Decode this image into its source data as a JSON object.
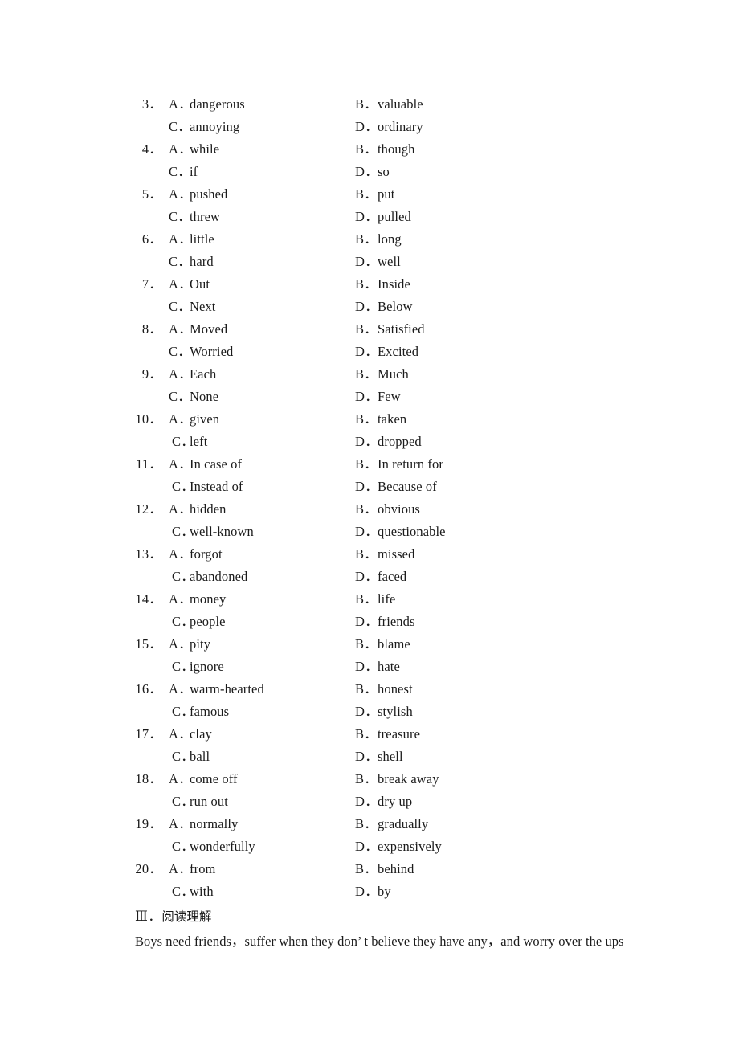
{
  "page": {
    "background_color": "#ffffff",
    "text_color": "#1b1b1b"
  },
  "questions": [
    {
      "number": "3．",
      "options": [
        {
          "label": "A．",
          "text": "dangerous"
        },
        {
          "label": "B．",
          "text": "valuable"
        },
        {
          "label": "C．",
          "text": "annoying"
        },
        {
          "label": "D．",
          "text": "ordinary"
        }
      ]
    },
    {
      "number": "4．",
      "options": [
        {
          "label": "A．",
          "text": "while"
        },
        {
          "label": "B．",
          "text": "though"
        },
        {
          "label": "C．",
          "text": "if"
        },
        {
          "label": "D．",
          "text": "so"
        }
      ]
    },
    {
      "number": "5．",
      "options": [
        {
          "label": "A．",
          "text": "pushed"
        },
        {
          "label": "B．",
          "text": "put"
        },
        {
          "label": "C．",
          "text": "threw"
        },
        {
          "label": "D．",
          "text": "pulled"
        }
      ]
    },
    {
      "number": "6．",
      "options": [
        {
          "label": "A．",
          "text": "little"
        },
        {
          "label": "B．",
          "text": "long"
        },
        {
          "label": "C．",
          "text": "hard"
        },
        {
          "label": "D．",
          "text": "well"
        }
      ]
    },
    {
      "number": "7．",
      "options": [
        {
          "label": "A．",
          "text": "Out"
        },
        {
          "label": "B．",
          "text": "Inside"
        },
        {
          "label": "C．",
          "text": "Next"
        },
        {
          "label": "D．",
          "text": "Below"
        }
      ]
    },
    {
      "number": "8．",
      "options": [
        {
          "label": "A．",
          "text": "Moved"
        },
        {
          "label": "B．",
          "text": "Satisfied"
        },
        {
          "label": "C．",
          "text": "Worried"
        },
        {
          "label": "D．",
          "text": "Excited"
        }
      ]
    },
    {
      "number": "9．",
      "options": [
        {
          "label": "A．",
          "text": "Each"
        },
        {
          "label": "B．",
          "text": "Much"
        },
        {
          "label": "C．",
          "text": "None"
        },
        {
          "label": "D．",
          "text": "Few"
        }
      ]
    },
    {
      "number": "10．",
      "options": [
        {
          "label": "A．",
          "text": "given"
        },
        {
          "label": "B．",
          "text": "taken"
        },
        {
          "label": "C．",
          "text": "left"
        },
        {
          "label": "D．",
          "text": "dropped"
        }
      ]
    },
    {
      "number": "11．",
      "options": [
        {
          "label": "A．",
          "text": "In case of"
        },
        {
          "label": "B．",
          "text": "In return for"
        },
        {
          "label": "C．",
          "text": "Instead of"
        },
        {
          "label": "D．",
          "text": "Because of"
        }
      ]
    },
    {
      "number": "12．",
      "options": [
        {
          "label": "A．",
          "text": "hidden"
        },
        {
          "label": "B．",
          "text": "obvious"
        },
        {
          "label": "C．",
          "text": "well-known"
        },
        {
          "label": "D．",
          "text": "questionable"
        }
      ]
    },
    {
      "number": "13．",
      "options": [
        {
          "label": "A．",
          "text": "forgot"
        },
        {
          "label": "B．",
          "text": "missed"
        },
        {
          "label": "C．",
          "text": "abandoned"
        },
        {
          "label": "D．",
          "text": "faced"
        }
      ]
    },
    {
      "number": "14．",
      "options": [
        {
          "label": "A．",
          "text": "money"
        },
        {
          "label": "B．",
          "text": "life"
        },
        {
          "label": "C．",
          "text": "people"
        },
        {
          "label": "D．",
          "text": "friends"
        }
      ]
    },
    {
      "number": "15．",
      "options": [
        {
          "label": "A．",
          "text": "pity"
        },
        {
          "label": "B．",
          "text": "blame"
        },
        {
          "label": "C．",
          "text": "ignore"
        },
        {
          "label": "D．",
          "text": "hate"
        }
      ]
    },
    {
      "number": "16．",
      "options": [
        {
          "label": "A．",
          "text": "warm-hearted"
        },
        {
          "label": "B．",
          "text": "honest"
        },
        {
          "label": "C．",
          "text": "famous"
        },
        {
          "label": "D．",
          "text": "stylish"
        }
      ]
    },
    {
      "number": "17．",
      "options": [
        {
          "label": "A．",
          "text": "clay"
        },
        {
          "label": "B．",
          "text": "treasure"
        },
        {
          "label": "C．",
          "text": "ball"
        },
        {
          "label": "D．",
          "text": "shell"
        }
      ]
    },
    {
      "number": "18．",
      "options": [
        {
          "label": "A．",
          "text": "come off"
        },
        {
          "label": "B．",
          "text": "break away"
        },
        {
          "label": "C．",
          "text": "run out"
        },
        {
          "label": "D．",
          "text": "dry up"
        }
      ]
    },
    {
      "number": "19．",
      "options": [
        {
          "label": "A．",
          "text": "normally"
        },
        {
          "label": "B．",
          "text": "gradually"
        },
        {
          "label": "C．",
          "text": "wonderfully"
        },
        {
          "label": "D．",
          "text": "expensively"
        }
      ]
    },
    {
      "number": "20．",
      "options": [
        {
          "label": "A．",
          "text": "from"
        },
        {
          "label": "B．",
          "text": "behind"
        },
        {
          "label": "C．",
          "text": "with"
        },
        {
          "label": "D．",
          "text": "by"
        }
      ]
    }
  ],
  "section": {
    "numeral": "Ⅲ．",
    "title": "阅读理解"
  },
  "passage": {
    "line1": "Boys need friends，suffer when they don’ t believe they have any，and worry over the ups"
  }
}
